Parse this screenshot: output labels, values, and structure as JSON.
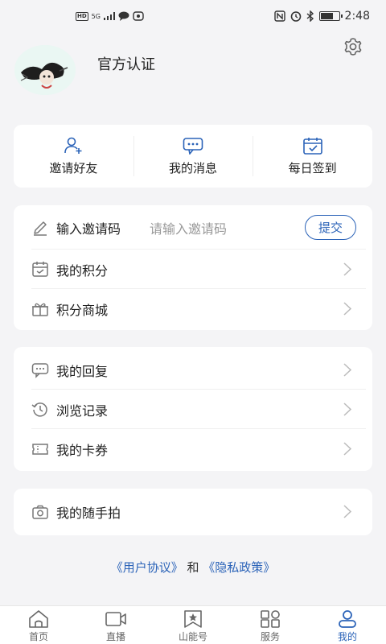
{
  "status_bar": {
    "network": "5G",
    "time": "2:48",
    "battery_level": 0.65
  },
  "profile": {
    "certification": "官方认证"
  },
  "quick_actions": [
    {
      "label": "邀请好友",
      "icon": "add-user-icon"
    },
    {
      "label": "我的消息",
      "icon": "message-icon"
    },
    {
      "label": "每日签到",
      "icon": "calendar-check-icon"
    }
  ],
  "invite": {
    "label": "输入邀请码",
    "placeholder": "请输入邀请码",
    "submit_label": "提交"
  },
  "menu_group1": [
    {
      "label": "我的积分",
      "icon": "points-icon"
    },
    {
      "label": "积分商城",
      "icon": "gift-icon"
    }
  ],
  "menu_group2": [
    {
      "label": "我的回复",
      "icon": "reply-icon"
    },
    {
      "label": "浏览记录",
      "icon": "history-icon"
    },
    {
      "label": "我的卡券",
      "icon": "ticket-icon"
    }
  ],
  "menu_group3": [
    {
      "label": "我的随手拍",
      "icon": "camera-icon"
    }
  ],
  "footer": {
    "user_agreement": "《用户协议》",
    "and": "和",
    "privacy_policy": "《隐私政策》"
  },
  "tabs": [
    {
      "label": "首页",
      "icon": "home-icon"
    },
    {
      "label": "直播",
      "icon": "video-icon"
    },
    {
      "label": "山能号",
      "icon": "bookmark-star-icon"
    },
    {
      "label": "服务",
      "icon": "grid-icon"
    },
    {
      "label": "我的",
      "icon": "user-icon",
      "active": true
    }
  ],
  "colors": {
    "accent": "#2b63b8",
    "icon_gray": "#666666",
    "background": "#f4f4f6"
  }
}
